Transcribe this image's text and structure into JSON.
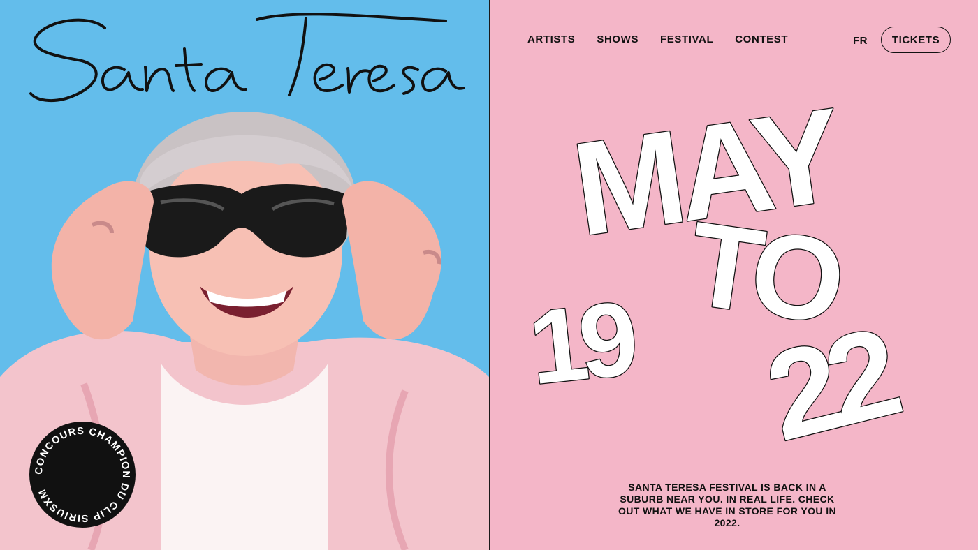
{
  "brand": {
    "logo_text": "Santa Teresa",
    "left_bg": "#63bdeb",
    "right_bg": "#f4b6c8"
  },
  "nav": {
    "items": [
      "ARTISTS",
      "SHOWS",
      "FESTIVAL",
      "CONTEST"
    ],
    "lang": "FR",
    "tickets_label": "TICKETS"
  },
  "hero": {
    "month": "MAY",
    "start_day": "19",
    "to": "TO",
    "end_day": "22"
  },
  "badge": {
    "text": "CONCOURS CHAMPION DU CLIP SIRIUSXM "
  },
  "tagline": "SANTA TERESA FESTIVAL IS BACK IN A SUBURB NEAR YOU. IN REAL LIFE. CHECK OUT WHAT WE HAVE IN STORE FOR YOU IN 2022."
}
